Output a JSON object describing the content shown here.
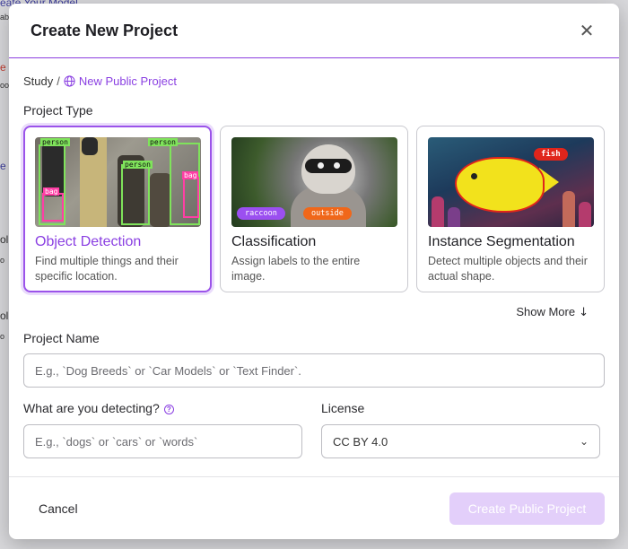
{
  "background": {
    "fragments": [
      "eate Your Model",
      "ab",
      "e",
      "oo",
      "e",
      "ol",
      "o",
      "ol",
      "o"
    ]
  },
  "modal": {
    "title": "Create New Project",
    "close_icon": "close-icon"
  },
  "breadcrumb": {
    "root": "Study",
    "separator": "/",
    "current": "New Public Project",
    "icon": "globe-icon"
  },
  "project_type": {
    "label": "Project Type",
    "cards": [
      {
        "title": "Object Detection",
        "description": "Find multiple things and their specific location.",
        "selected": true,
        "tags": [
          "person",
          "person",
          "person",
          "bag",
          "bag"
        ]
      },
      {
        "title": "Classification",
        "description": "Assign labels to the entire image.",
        "selected": false,
        "tags": [
          "raccoon",
          "outside"
        ]
      },
      {
        "title": "Instance Segmentation",
        "description": "Detect multiple objects and their actual shape.",
        "selected": false,
        "tags": [
          "fish"
        ]
      }
    ],
    "show_more": "Show More"
  },
  "project_name": {
    "label": "Project Name",
    "placeholder": "E.g., `Dog Breeds` or `Car Models` or `Text Finder`."
  },
  "detecting": {
    "label": "What are you detecting?",
    "placeholder": "E.g., `dogs` or `cars` or `words`"
  },
  "license": {
    "label": "License",
    "value": "CC BY 4.0"
  },
  "footer": {
    "cancel": "Cancel",
    "create": "Create Public Project"
  },
  "colors": {
    "accent": "#8a3fe2",
    "create_disabled": "#e3cffa"
  }
}
